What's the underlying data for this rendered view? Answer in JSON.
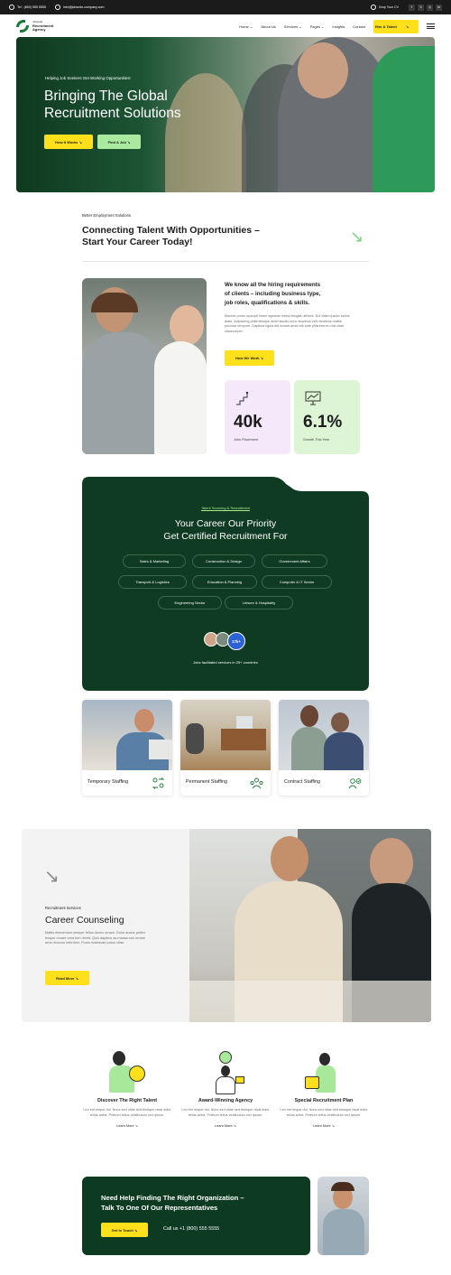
{
  "topbar": {
    "phone": "Tel : (800) 555 5555",
    "email": "Info@jobsede-company.com",
    "cv_label": "Drop Your CV",
    "socials": [
      "f",
      "𝕏",
      "◎",
      "in"
    ]
  },
  "header": {
    "logo_small": "Jobsede",
    "logo_line1": "Recruitment",
    "logo_line2": "Agency",
    "nav": [
      "Home",
      "About Us",
      "Services",
      "Pages",
      "Insights",
      "Contact"
    ],
    "cta": "Hire A Talent"
  },
  "hero": {
    "kicker": "Helping Job Seekers Get Working Opportunities!",
    "title_line1": "Bringing The Global",
    "title_line2": "Recruitment Solutions",
    "btn_primary": "How It Works",
    "btn_secondary": "Find A Job"
  },
  "intro": {
    "tag": "Better Employment Solutions",
    "title_line1": "Connecting Talent With Opportunities –",
    "title_line2": "Start Your Career Today!"
  },
  "about": {
    "title_line1": "We know all the hiring requirements",
    "title_line2": "of clients – including business type,",
    "title_line3": "job roles, qualifications & skills.",
    "body": "Montes purus suscipit lorem egestas metus feugiat ultrices. Dui vitam ipsum luctus diam. Adipiscing pellentesque amet iaculis nunc faucibus vels faucibus mattis pulvinar tempore. Dapibus ligula elit ornare amet elit ante pharetra eu nisi vitae ullamcorper.",
    "cta": "How We Work",
    "stats": [
      {
        "value": "40k",
        "label": "Jobs Placement",
        "color": "#f5e8fb"
      },
      {
        "value": "6.1%",
        "label": "Growth This Year",
        "color": "#ddf5d4"
      }
    ]
  },
  "sourcing": {
    "tag": "Talent Sourcing & Recruitment",
    "title_line1": "Your Career Our Priority",
    "title_line2": "Get Certified Recruitment For",
    "chips": [
      "Sales & Marketing",
      "Construction & Design",
      "Government Affairs",
      "Transport & Logistics",
      "Education & Planning",
      "Computer & IT Sector",
      "Engineering Sector",
      "Leisure & Hospitality"
    ],
    "badge": "17k+",
    "footnote": "Jobs facilitated services in 25+ countries"
  },
  "staffing": [
    {
      "label": "Temporary Staffing"
    },
    {
      "label": "Permanent Staffing"
    },
    {
      "label": "Contract Staffing"
    }
  ],
  "counseling": {
    "tag": "Recruitment Services",
    "title": "Career Counseling",
    "body": "Mattis elementum semper tellus donec ornare. Dolor auctor pellen tesque ornare urna hen dreirit. Quis dapibus as massa non ornare urna rhoncus interdum. Purus malesuad purus vitae.",
    "cta": "Read More"
  },
  "features": [
    {
      "title": "Discover The Right Talent",
      "body": "Leo est neque dui. Nunc sed vitae sed tristique nisal dolor tellus antra. Pretium tellus vestibulum orci ipsum.",
      "link": "Learn More"
    },
    {
      "title": "Award-Winning Agency",
      "body": "Leo est neque dui. Nunc sed vitae sed tristique nisal dolor tellus antra. Pretium tellus vestibulum orci ipsum.",
      "link": "Learn More"
    },
    {
      "title": "Special Recruitment Plan",
      "body": "Leo est neque dui. Nunc sed vitae sed tristique nisal dolor tellus antra. Pretium tellus vestibulum orci ipsum.",
      "link": "Learn More"
    }
  ],
  "cta": {
    "title_line1": "Need Help Finding The Right Organization –",
    "title_line2": "Talk To One Of Our Representatives",
    "button": "Get In Touch",
    "phone": "Call us +1 (800) 555 5555"
  },
  "colors": {
    "accent_yellow": "#ffe01b",
    "brand_green": "#0d3b22",
    "light_green": "#7dd37d"
  }
}
